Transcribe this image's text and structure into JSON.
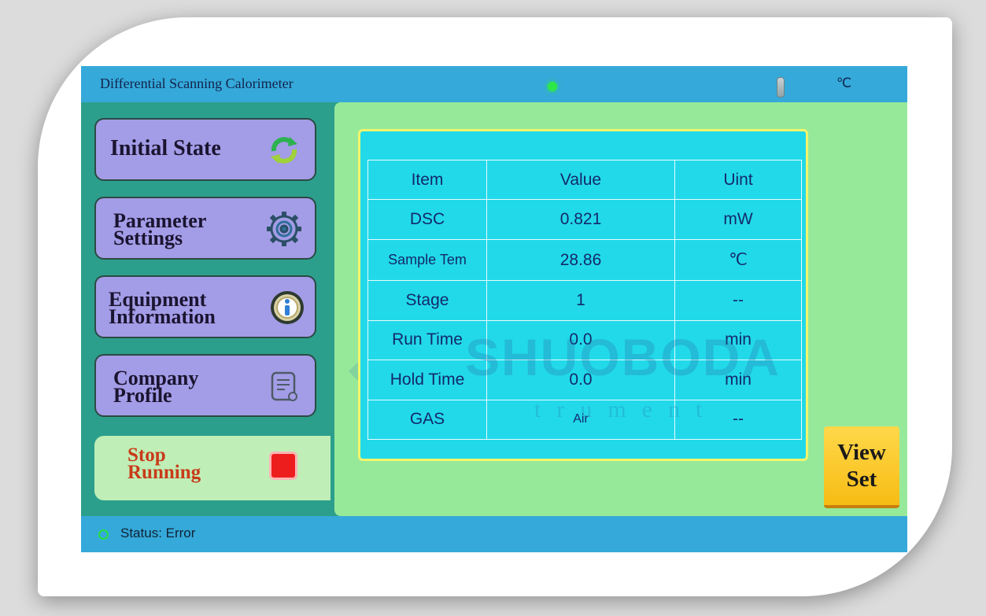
{
  "window": {
    "title": "Differential Scanning Calorimeter",
    "temperature_unit": "℃",
    "status_led_color": "#2ee84a"
  },
  "sidebar": {
    "items": [
      {
        "label": "Initial State",
        "icon": "recycle-arrows-icon"
      },
      {
        "label_line1": "Parameter",
        "label_line2": "Settings",
        "icon": "gear-icon"
      },
      {
        "label_line1": "Equipment",
        "label_line2": "Information",
        "icon": "info-badge-icon"
      },
      {
        "label_line1": "Company",
        "label_line2": "Profile",
        "icon": "document-icon"
      }
    ],
    "stop": {
      "line1": "Stop",
      "line2": "Running",
      "icon": "stop-square-icon",
      "color": "#ee1d1d"
    }
  },
  "table": {
    "headers": [
      "Item",
      "Value",
      "Uint"
    ],
    "rows": [
      [
        "DSC",
        "0.821",
        "mW"
      ],
      [
        "Sample Tem",
        "28.86",
        "℃"
      ],
      [
        "Stage",
        "1",
        "--"
      ],
      [
        "Run Time",
        "0.0",
        "min"
      ],
      [
        "Hold Time",
        "0.0",
        "min"
      ],
      [
        "GAS",
        "Air",
        "--"
      ]
    ]
  },
  "view_set": {
    "line1": "View",
    "line2": "Set"
  },
  "status": {
    "text": "Status:  Error"
  },
  "watermark": {
    "brand": "SHUOBODA",
    "tagline": "trument"
  },
  "colors": {
    "titlebar": "#35a9d9",
    "frame_green": "#2c9f8c",
    "panel_green": "#97e99a",
    "button_purple": "#a39ce6",
    "table_cyan": "#22d9e9",
    "view_set_yellow": "#f6bc14"
  }
}
